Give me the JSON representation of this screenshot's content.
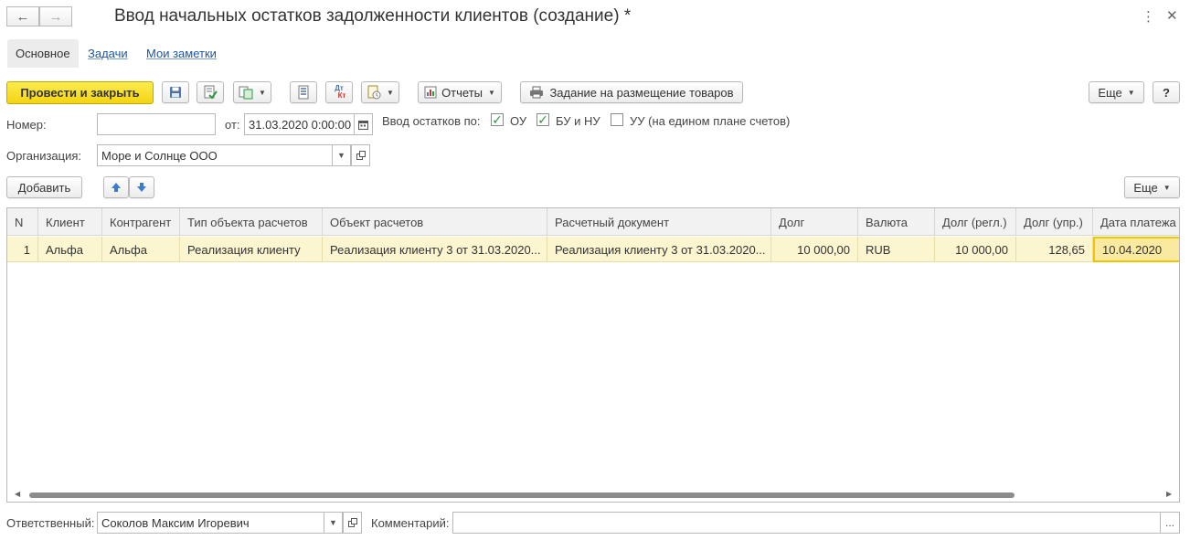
{
  "window": {
    "title": "Ввод начальных остатков задолженности клиентов (создание) *"
  },
  "tabs": [
    {
      "label": "Основное"
    },
    {
      "label": "Задачи"
    },
    {
      "label": "Мои заметки"
    }
  ],
  "toolbar": {
    "post_and_close": "Провести и закрыть",
    "reports": "Отчеты",
    "placement_task": "Задание на размещение товаров",
    "more": "Еще",
    "help": "?",
    "dtkt_top": "Дт",
    "dtkt_bottom": "Кт"
  },
  "header_fields": {
    "number_label": "Номер:",
    "number_value": "",
    "date_label": "от:",
    "date_value": "31.03.2020  0:00:00",
    "balance_label": "Ввод остатков по:",
    "chk_ou": {
      "label": "ОУ",
      "checked": true
    },
    "chk_bu": {
      "label": "БУ и НУ",
      "checked": true
    },
    "chk_uu": {
      "label": "УУ (на едином плане счетов)",
      "checked": false
    },
    "org_label": "Организация:",
    "org_value": "Море и Солнце ООО"
  },
  "table_toolbar": {
    "add": "Добавить",
    "more": "Еще"
  },
  "table": {
    "columns": [
      "N",
      "Клиент",
      "Контрагент",
      "Тип объекта расчетов",
      "Объект расчетов",
      "Расчетный документ",
      "Долг",
      "Валюта",
      "Долг (регл.)",
      "Долг (упр.)",
      "Дата платежа"
    ],
    "rows": [
      [
        "1",
        "Альфа",
        "Альфа",
        "Реализация клиенту",
        "Реализация клиенту 3 от 31.03.2020...",
        "Реализация клиенту 3 от 31.03.2020...",
        "10 000,00",
        "RUB",
        "10 000,00",
        "128,65",
        "10.04.2020"
      ]
    ]
  },
  "footer": {
    "responsible_label": "Ответственный:",
    "responsible_value": "Соколов Максим Игоревич",
    "comment_label": "Комментарий:",
    "comment_value": "",
    "comment_btn": "..."
  },
  "colors": {
    "primary_button": "#f4d312",
    "row_highlight": "#fbf5d0",
    "link": "#1a56a8",
    "check": "#2e9a3c"
  },
  "icons": [
    "back-arrow-icon",
    "forward-arrow-icon",
    "save-icon",
    "post-icon",
    "create-based-icon",
    "list-icon",
    "dtkt-icon",
    "attach-icon",
    "reports-icon",
    "printer-icon",
    "arrow-up-icon",
    "arrow-down-icon",
    "calendar-icon",
    "more-vertical-icon",
    "close-icon"
  ]
}
